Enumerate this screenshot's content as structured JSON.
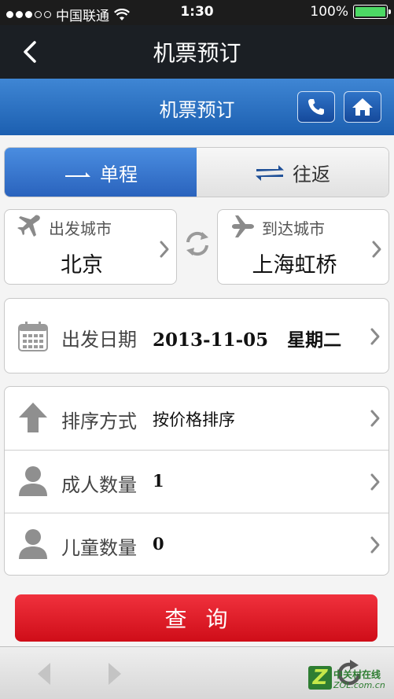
{
  "status_bar": {
    "carrier": "中国联通",
    "time": "1:30",
    "battery": "100%",
    "signal_bars": 3
  },
  "nav": {
    "title": "机票预订"
  },
  "header": {
    "title": "机票预订"
  },
  "trip_type": {
    "one_way": "单程",
    "round_trip": "往返",
    "selected": "one_way"
  },
  "departure_city": {
    "caption": "出发城市",
    "value": "北京"
  },
  "arrival_city": {
    "caption": "到达城市",
    "value": "上海虹桥"
  },
  "departure_date": {
    "label": "出发日期",
    "value": "2013-11-05",
    "weekday": "星期二"
  },
  "options": {
    "sort": {
      "label": "排序方式",
      "value": "按价格排序"
    },
    "adults": {
      "label": "成人数量",
      "value": "1"
    },
    "children": {
      "label": "儿童数量",
      "value": "0"
    }
  },
  "query_button": "查询",
  "watermark": {
    "line1": "中关村在线",
    "line2": "ZOL.com.cn"
  },
  "colors": {
    "accent_blue": "#2a63bd",
    "query_red": "#e0101c",
    "battery_green": "#4cd964"
  }
}
